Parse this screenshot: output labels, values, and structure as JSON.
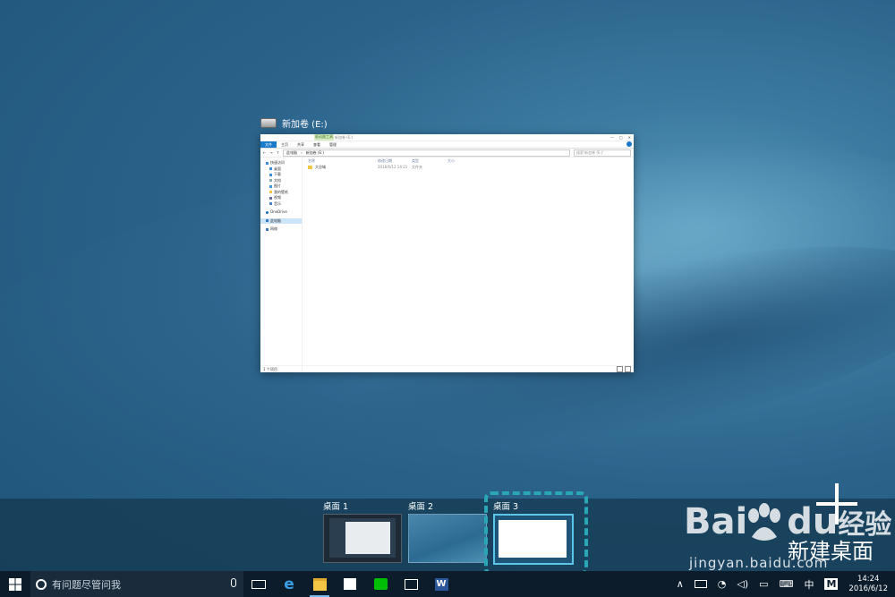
{
  "window": {
    "title": "新加卷 (E:)",
    "ribbon_context_tab": "驱动器工具",
    "ribbon_title": "新加卷 (E:)",
    "ribbon_tabs": [
      "文件",
      "主页",
      "共享",
      "查看",
      "管理"
    ],
    "address": [
      "此电脑",
      "新加卷 (E:)"
    ],
    "search_placeholder": "搜索'新加卷 (E:)'",
    "nav": [
      "快速访问",
      "桌面",
      "下载",
      "文档",
      "图片",
      "我的壁纸",
      "视频",
      "音乐",
      "OneDrive",
      "此电脑",
      "网络"
    ],
    "columns": [
      "名称",
      "修改日期",
      "类型",
      "大小"
    ],
    "files": [
      {
        "name": "大谷城",
        "date": "2016/6/12 14:21",
        "type": "文件夹",
        "size": ""
      }
    ],
    "status": "1 个项目"
  },
  "task_view": {
    "desktops": [
      "桌面 1",
      "桌面 2",
      "桌面 3"
    ],
    "new_desktop_label": "新建桌面"
  },
  "watermark": {
    "brand": "Bai",
    "brand2": "du",
    "brand_cn": "经验",
    "url": "jingyan.baidu.com"
  },
  "taskbar": {
    "search_placeholder": "有问题尽管问我",
    "apps": [
      "edge-icon",
      "file-explorer-icon",
      "store-icon",
      "iqiyi-icon",
      "photos-icon",
      "word-icon"
    ],
    "ime_lang": "中",
    "ime_mode": "M",
    "time": "14:24",
    "date": "2016/6/12"
  }
}
